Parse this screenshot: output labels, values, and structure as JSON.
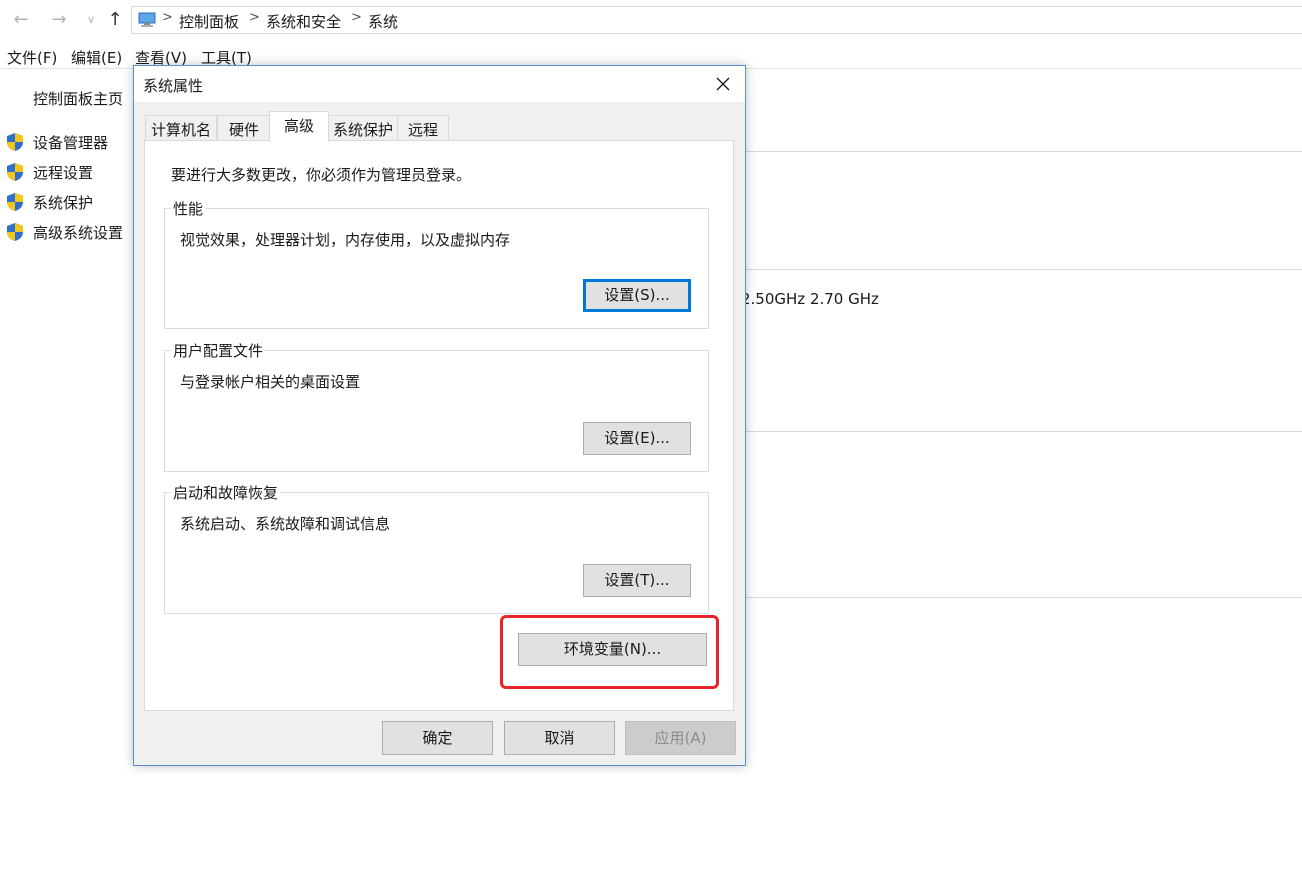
{
  "breadcrumb": {
    "items": [
      "控制面板",
      "系统和安全",
      "系统"
    ],
    "separator": ">"
  },
  "menubar": {
    "items": [
      "文件(F)",
      "编辑(E)",
      "查看(V)",
      "工具(T)"
    ]
  },
  "sidebar": {
    "home": "控制面板主页",
    "links": [
      "设备管理器",
      "远程设置",
      "系统保护",
      "高级系统设置"
    ]
  },
  "background": {
    "cpu_speed": "2.50GHz   2.70 GHz"
  },
  "dialog": {
    "title": "系统属性",
    "tabs": [
      "计算机名",
      "硬件",
      "高级",
      "系统保护",
      "远程"
    ],
    "active_tab": "高级",
    "admin_note": "要进行大多数更改，你必须作为管理员登录。",
    "groups": {
      "performance": {
        "label": "性能",
        "description": "视觉效果，处理器计划，内存使用，以及虚拟内存",
        "button": "设置(S)..."
      },
      "user_profiles": {
        "label": "用户配置文件",
        "description": "与登录帐户相关的桌面设置",
        "button": "设置(E)..."
      },
      "startup_recovery": {
        "label": "启动和故障恢复",
        "description": "系统启动、系统故障和调试信息",
        "button": "设置(T)..."
      }
    },
    "env_button": "环境变量(N)...",
    "ok": "确定",
    "cancel": "取消",
    "apply": "应用(A)"
  },
  "colors": {
    "accent": "#0078d7",
    "highlight": "#e5242b"
  }
}
